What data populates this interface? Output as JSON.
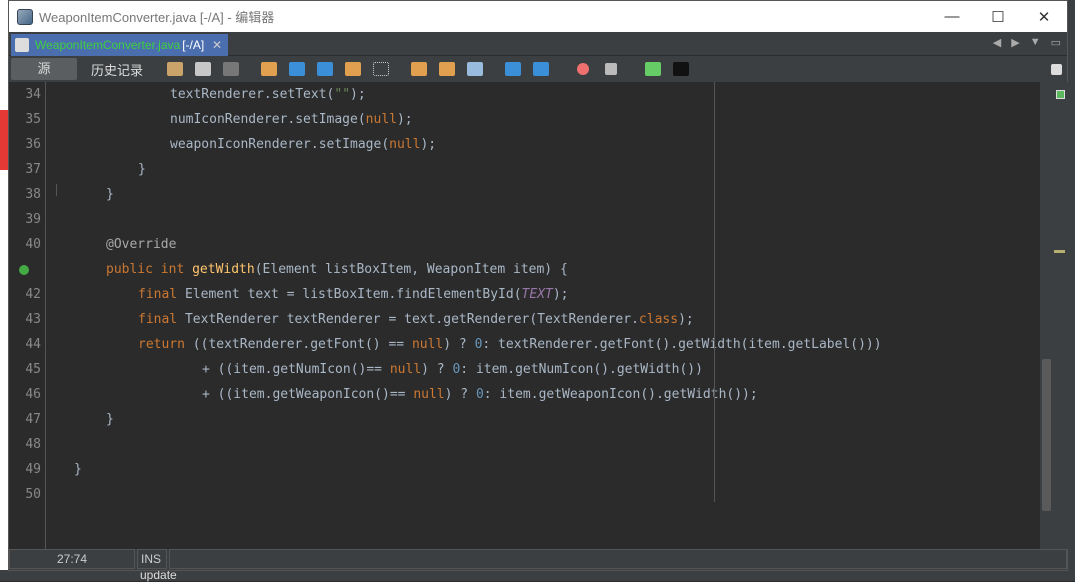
{
  "window": {
    "title": "WeaponItemConverter.java [-/A] - 编辑器",
    "controls": [
      "—",
      "☐",
      "✕"
    ]
  },
  "tab": {
    "filename": "WeaponItemConverter.java",
    "status": "[-/A]",
    "close": "✕"
  },
  "toolbar": {
    "source_label": "源",
    "history_label": "历史记录"
  },
  "colors": {
    "keyword": "#cc7832",
    "method": "#ffc66d",
    "number": "#6897bb",
    "constant": "#9876aa",
    "tab_active": "#4b6eaf",
    "filename": "#3fd03f"
  },
  "code": {
    "lines": [
      {
        "num": "34",
        "indent": 12,
        "tokens": [
          [
            "",
            "textRenderer.setText("
          ],
          [
            "s",
            "\"\""
          ],
          [
            "",
            ");"
          ]
        ]
      },
      {
        "num": "35",
        "indent": 12,
        "tokens": [
          [
            "",
            "numIconRenderer.setImage("
          ],
          [
            "k",
            "null"
          ],
          [
            "",
            ");"
          ]
        ]
      },
      {
        "num": "36",
        "indent": 12,
        "tokens": [
          [
            "",
            "weaponIconRenderer.setImage("
          ],
          [
            "k",
            "null"
          ],
          [
            "",
            ");"
          ]
        ]
      },
      {
        "num": "37",
        "indent": 8,
        "tokens": [
          [
            "",
            "}"
          ]
        ]
      },
      {
        "num": "38",
        "indent": 4,
        "tokens": [
          [
            "",
            "}"
          ]
        ]
      },
      {
        "num": "39",
        "indent": 0,
        "tokens": []
      },
      {
        "num": "40",
        "indent": 4,
        "tokens": [
          [
            "a",
            "@Override"
          ]
        ]
      },
      {
        "num": "",
        "indent": 4,
        "tokens": [
          [
            "k",
            "public int "
          ],
          [
            "m",
            "getWidth"
          ],
          [
            "",
            "(Element listBoxItem, WeaponItem item) {"
          ]
        ]
      },
      {
        "num": "42",
        "indent": 8,
        "tokens": [
          [
            "k",
            "final "
          ],
          [
            "",
            "Element text = listBoxItem.findElementById("
          ],
          [
            "c",
            "TEXT"
          ],
          [
            "",
            ");"
          ]
        ]
      },
      {
        "num": "43",
        "indent": 8,
        "tokens": [
          [
            "k",
            "final "
          ],
          [
            "",
            "TextRenderer textRenderer = text.getRenderer(TextRenderer."
          ],
          [
            "k",
            "class"
          ],
          [
            "",
            ");"
          ]
        ]
      },
      {
        "num": "44",
        "indent": 8,
        "tokens": [
          [
            "k",
            "return "
          ],
          [
            "",
            "((textRenderer.getFont() == "
          ],
          [
            "k",
            "null"
          ],
          [
            "",
            ") ? "
          ],
          [
            "n",
            "0"
          ],
          [
            "",
            ": textRenderer.getFont().getWidth(item.getLabel()))"
          ]
        ]
      },
      {
        "num": "45",
        "indent": 16,
        "tokens": [
          [
            "",
            "+ ((item.getNumIcon()== "
          ],
          [
            "k",
            "null"
          ],
          [
            "",
            ") ? "
          ],
          [
            "n",
            "0"
          ],
          [
            "",
            ": item.getNumIcon().getWidth())"
          ]
        ]
      },
      {
        "num": "46",
        "indent": 16,
        "tokens": [
          [
            "",
            "+ ((item.getWeaponIcon()== "
          ],
          [
            "k",
            "null"
          ],
          [
            "",
            ") ? "
          ],
          [
            "n",
            "0"
          ],
          [
            "",
            ": item.getWeaponIcon().getWidth());"
          ]
        ]
      },
      {
        "num": "47",
        "indent": 4,
        "tokens": [
          [
            "",
            "}"
          ]
        ]
      },
      {
        "num": "48",
        "indent": 0,
        "tokens": []
      },
      {
        "num": "49",
        "indent": 0,
        "tokens": [
          [
            "",
            "}"
          ]
        ]
      },
      {
        "num": "50",
        "indent": 0,
        "tokens": []
      }
    ]
  },
  "status": {
    "position": "27:74",
    "mode": "INS"
  },
  "background": {
    "behind_text": "update"
  }
}
